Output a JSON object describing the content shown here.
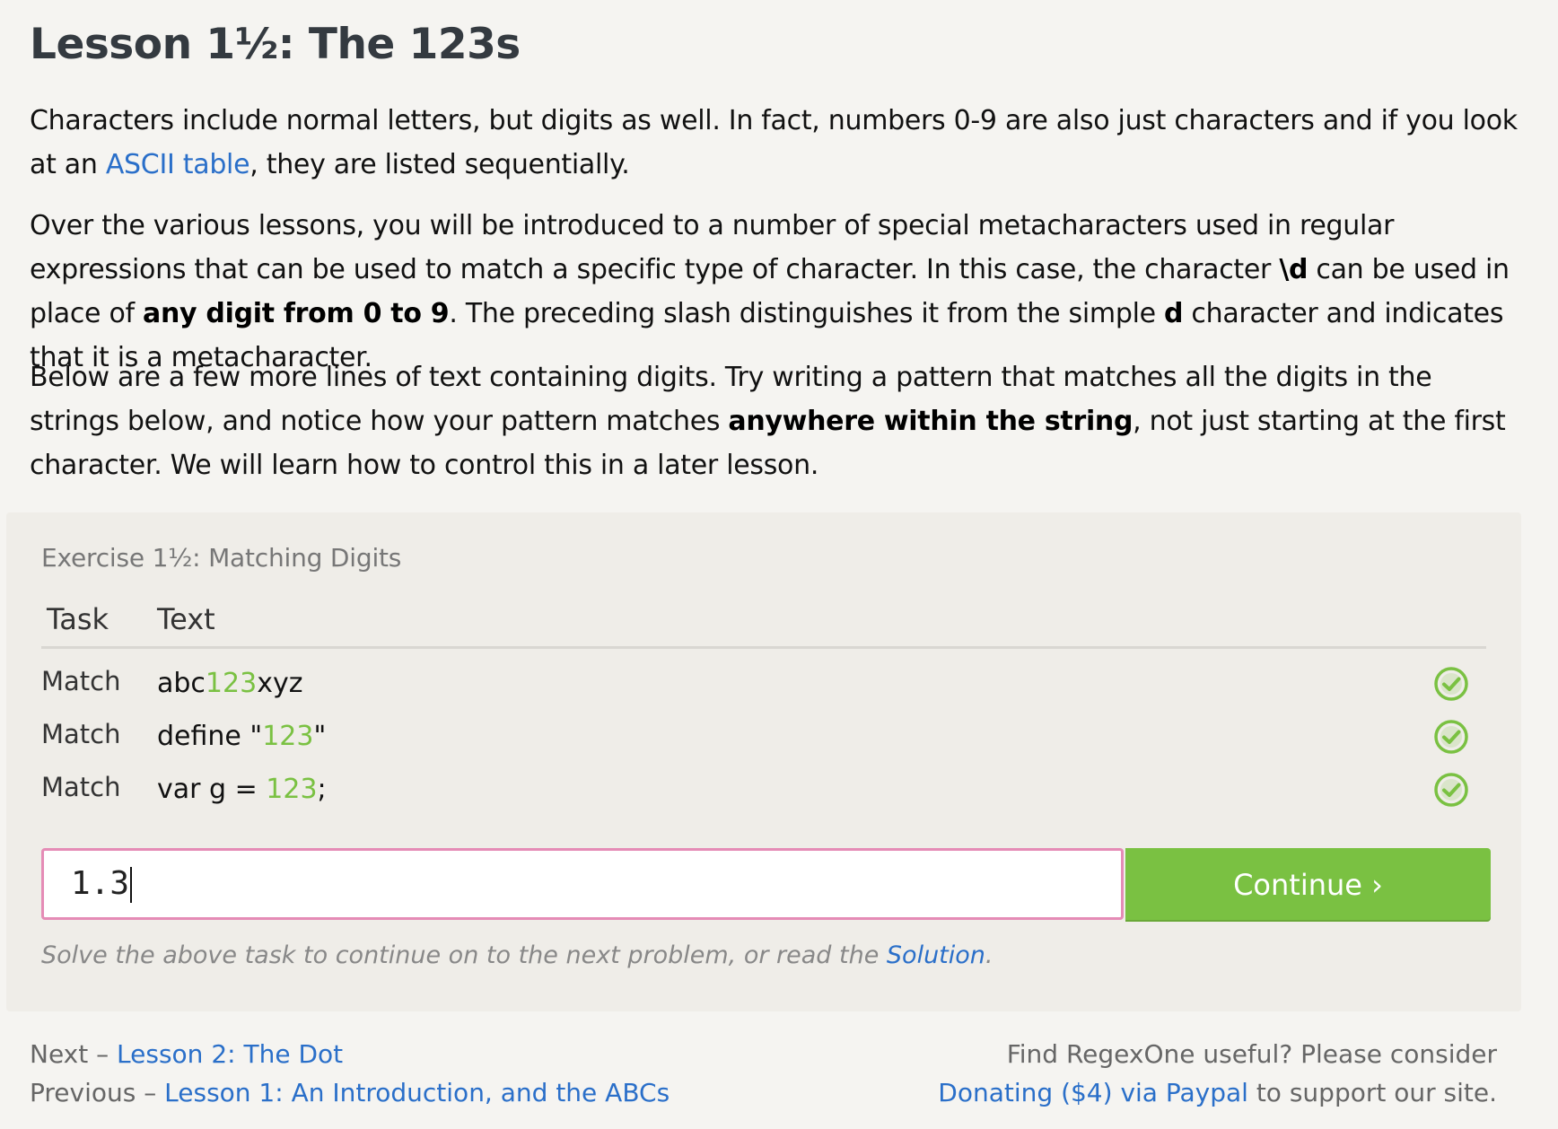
{
  "lesson": {
    "title": "Lesson 1½: The 123s",
    "p1_a": "Characters include normal letters, but digits as well. In fact, numbers 0-9 are also just characters and if you look at an ",
    "p1_link": "ASCII table",
    "p1_b": ", they are listed sequentially.",
    "p2_a": "Over the various lessons, you will be introduced to a number of special metacharacters used in regular expressions that can be used to match a specific type of character. In this case, the character ",
    "p2_b1": "\\d",
    "p2_c": " can be used in place of ",
    "p2_b2": "any digit from 0 to 9",
    "p2_d": ". The preceding slash distinguishes it from the simple ",
    "p2_b3": "d",
    "p2_e": " character and indicates that it is a metacharacter.",
    "p3_a": "Below are a few more lines of text containing digits. Try writing a pattern that matches all the digits in the strings below, and notice how your pattern matches ",
    "p3_b": "anywhere within the string",
    "p3_c": ", not just starting at the first character. We will learn how to control this in a later lesson."
  },
  "exercise": {
    "title": "Exercise 1½: Matching Digits",
    "col_task": "Task",
    "col_text": "Text",
    "rows": [
      {
        "task": "Match",
        "pre": "abc",
        "match": "123",
        "post": "xyz",
        "status": "check-icon"
      },
      {
        "task": "Match",
        "pre": "define \"",
        "match": "123",
        "post": "\"",
        "status": "check-icon"
      },
      {
        "task": "Match",
        "pre": "var g = ",
        "match": "123",
        "post": ";",
        "status": "check-icon"
      }
    ],
    "input_value": "1.3",
    "continue_label": "Continue ›",
    "hint_a": "Solve the above task to continue on to the next problem, or read the ",
    "hint_link": "Solution",
    "hint_b": ".",
    "colors": {
      "match": "#7ac142",
      "button": "#7ac142",
      "input_border": "#e58cb6",
      "link": "#2a6fc9"
    }
  },
  "footer": {
    "next_prefix": "Next – ",
    "next_link": "Lesson 2: The Dot",
    "prev_prefix": "Previous – ",
    "prev_link": "Lesson 1: An Introduction, and the ABCs",
    "promo_line1": "Find RegexOne useful? Please consider",
    "promo_link": "Donating ($4) via Paypal",
    "promo_suffix": " to support our site."
  }
}
